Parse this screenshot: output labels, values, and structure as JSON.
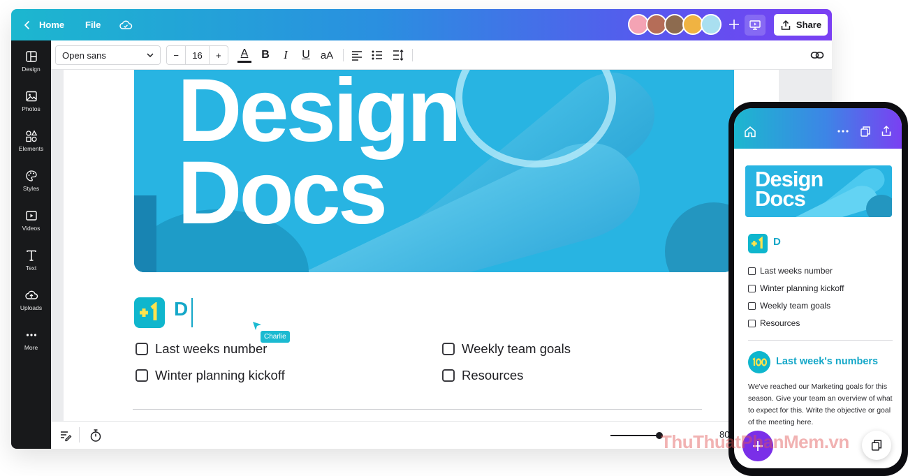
{
  "topbar": {
    "home_label": "Home",
    "file_label": "File",
    "share_label": "Share"
  },
  "collaborators": [
    "#f4a3b4",
    "#b56d58",
    "#8d6b4f",
    "#f0b342",
    "#a9dff0"
  ],
  "sidebar": {
    "items": [
      {
        "label": "Design",
        "icon": "design-icon"
      },
      {
        "label": "Photos",
        "icon": "photos-icon"
      },
      {
        "label": "Elements",
        "icon": "elements-icon"
      },
      {
        "label": "Styles",
        "icon": "styles-icon"
      },
      {
        "label": "Videos",
        "icon": "videos-icon"
      },
      {
        "label": "Text",
        "icon": "text-icon"
      },
      {
        "label": "Uploads",
        "icon": "uploads-icon"
      },
      {
        "label": "More",
        "icon": "more-icon"
      }
    ]
  },
  "toolbar": {
    "font_family": "Open sans",
    "font_size": "16",
    "minus": "−",
    "plus": "+",
    "text_color_glyph": "A",
    "bold_glyph": "B",
    "italic_glyph": "I",
    "underline_glyph": "U",
    "case_glyph": "aA"
  },
  "document": {
    "hero_line1": "Design",
    "hero_line2": "Docs",
    "heading_text": "D",
    "collaborator_cursor": "Charlie",
    "checklist": [
      "Last weeks number",
      "Winter planning kickoff",
      "Weekly team goals",
      "Resources"
    ]
  },
  "footer": {
    "zoom": "80",
    "zoom_level": 0.8
  },
  "mobile": {
    "hero_line1": "Design",
    "hero_line2": "Docs",
    "heading_text": "D",
    "checklist": [
      "Last weeks number",
      "Winter planning kickoff",
      "Weekly team goals",
      "Resources"
    ],
    "section_title": "Last week's numbers",
    "paragraph": "We've reached our Marketing goals for this season. Give your team an overview of what to expect for this. Write the objective or goal of the meeting here."
  },
  "watermark": "ThuThuatPhanMem.vn",
  "colors": {
    "accent_teal": "#14a7c8",
    "hero_blue": "#27b3e1",
    "sidebar": "#18191b",
    "purple": "#7a2fe8"
  }
}
